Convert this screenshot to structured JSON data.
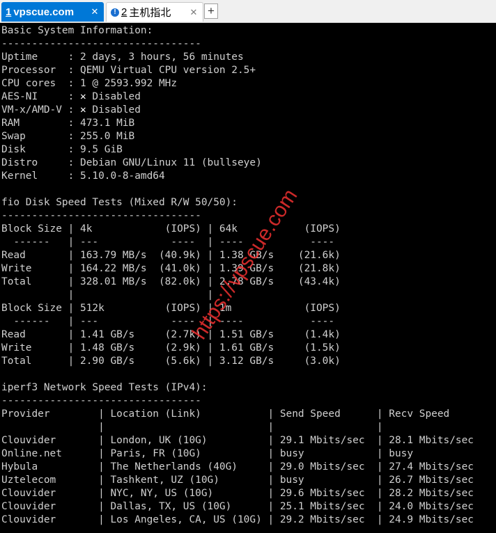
{
  "tabs": [
    {
      "number": "1",
      "title": "vpscue.com",
      "active": true
    },
    {
      "number": "2",
      "title": "主机指北",
      "active": false
    }
  ],
  "tab_add_label": "+",
  "tab_close_glyph": "✕",
  "status_glyph": "!",
  "watermark": "https://vpscue.com",
  "colors": {
    "active_tab": "#0078d7",
    "terminal_bg": "#000000",
    "terminal_fg": "#d0d0d0",
    "watermark": "#ee3030"
  },
  "terminal": {
    "lines": [
      "Basic System Information:",
      "---------------------------------",
      "Uptime     : 2 days, 3 hours, 56 minutes",
      "Processor  : QEMU Virtual CPU version 2.5+",
      "CPU cores  : 1 @ 2593.992 MHz",
      "AES-NI     : ✕ Disabled",
      "VM-x/AMD-V : ✕ Disabled",
      "RAM        : 473.1 MiB",
      "Swap       : 255.0 MiB",
      "Disk       : 9.5 GiB",
      "Distro     : Debian GNU/Linux 11 (bullseye)",
      "Kernel     : 5.10.0-8-amd64",
      "",
      "fio Disk Speed Tests (Mixed R/W 50/50):",
      "---------------------------------",
      "Block Size | 4k            (IOPS) | 64k           (IOPS)",
      "  ------   | ---            ----  | ----           ----",
      "Read       | 163.79 MB/s  (40.9k) | 1.38 GB/s    (21.6k)",
      "Write      | 164.22 MB/s  (41.0k) | 1.39 GB/s    (21.8k)",
      "Total      | 328.01 MB/s  (82.0k) | 2.78 GB/s    (43.4k)",
      "           |                      |",
      "Block Size | 512k          (IOPS) | 1m            (IOPS)",
      "  ------   | ---            ----  | ----           ----",
      "Read       | 1.41 GB/s     (2.7k) | 1.51 GB/s     (1.4k)",
      "Write      | 1.48 GB/s     (2.9k) | 1.61 GB/s     (1.5k)",
      "Total      | 2.90 GB/s     (5.6k) | 3.12 GB/s     (3.0k)",
      "",
      "iperf3 Network Speed Tests (IPv4):",
      "---------------------------------",
      "Provider        | Location (Link)           | Send Speed      | Recv Speed",
      "                |                           |                 |",
      "Clouvider       | London, UK (10G)          | 29.1 Mbits/sec  | 28.1 Mbits/sec",
      "Online.net      | Paris, FR (10G)           | busy            | busy",
      "Hybula          | The Netherlands (40G)     | 29.0 Mbits/sec  | 27.4 Mbits/sec",
      "Uztelecom       | Tashkent, UZ (10G)        | busy            | 26.7 Mbits/sec",
      "Clouvider       | NYC, NY, US (10G)         | 29.6 Mbits/sec  | 28.2 Mbits/sec",
      "Clouvider       | Dallas, TX, US (10G)      | 25.1 Mbits/sec  | 24.0 Mbits/sec",
      "Clouvider       | Los Angeles, CA, US (10G) | 29.2 Mbits/sec  | 24.9 Mbits/sec"
    ]
  }
}
